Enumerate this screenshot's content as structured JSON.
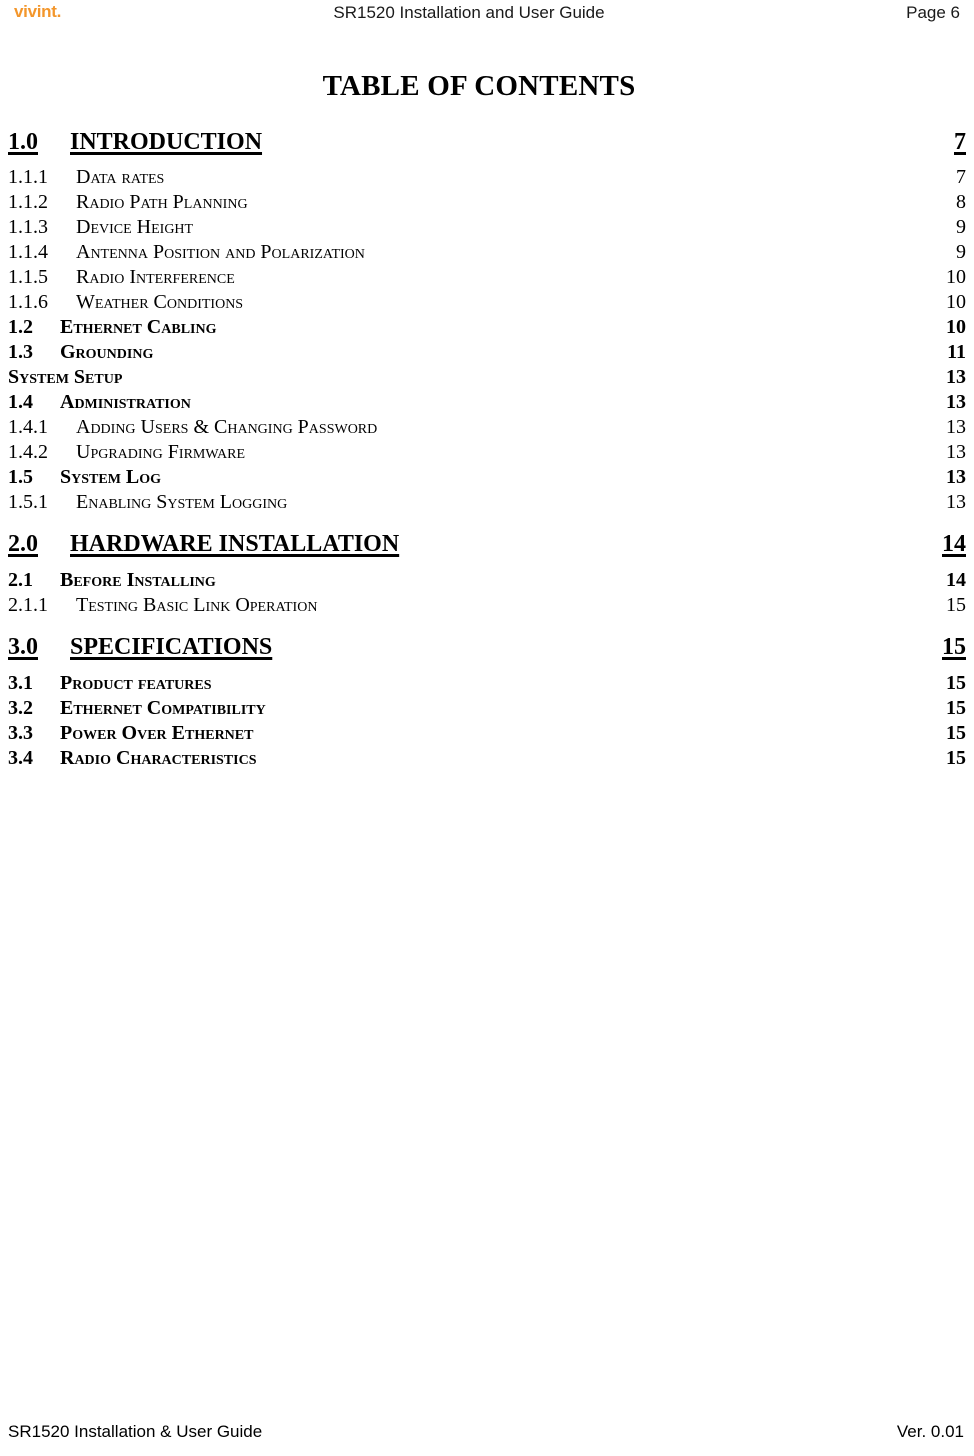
{
  "header": {
    "logo_text": "vivint.",
    "logo_color": "#F3962B",
    "title": "SR1520 Installation and User Guide",
    "page_label": "Page 6"
  },
  "toc": {
    "heading": "TABLE OF CONTENTS",
    "entries": [
      {
        "level": 1,
        "number": "1.0",
        "title": "INTRODUCTION",
        "page": "7"
      },
      {
        "level": 3,
        "number": "1.1.1",
        "title": "Data rates",
        "page": "7"
      },
      {
        "level": 3,
        "number": "1.1.2",
        "title": "Radio Path Planning",
        "page": "8"
      },
      {
        "level": 3,
        "number": "1.1.3",
        "title": "Device Height",
        "page": "9"
      },
      {
        "level": 3,
        "number": "1.1.4",
        "title": "Antenna Position and Polarization",
        "page": "9"
      },
      {
        "level": 3,
        "number": "1.1.5",
        "title": "Radio Interference",
        "page": "10"
      },
      {
        "level": 3,
        "number": "1.1.6",
        "title": "Weather Conditions",
        "page": "10"
      },
      {
        "level": 2,
        "number": "1.2",
        "title": "Ethernet Cabling",
        "page": "10"
      },
      {
        "level": 2,
        "number": "1.3",
        "title": "Grounding",
        "page": "11"
      },
      {
        "level": 2,
        "number": "",
        "title": "System Setup",
        "page": "13"
      },
      {
        "level": 2,
        "number": "1.4",
        "title": "Administration",
        "page": "13"
      },
      {
        "level": 3,
        "number": "1.4.1",
        "title": "Adding Users & Changing Password",
        "page": "13"
      },
      {
        "level": 3,
        "number": "1.4.2",
        "title": "Upgrading Firmware",
        "page": "13"
      },
      {
        "level": 2,
        "number": "1.5",
        "title": "System Log",
        "page": "13"
      },
      {
        "level": 3,
        "number": "1.5.1",
        "title": "Enabling System Logging",
        "page": "13"
      },
      {
        "level": 1,
        "number": "2.0",
        "title": "HARDWARE INSTALLATION",
        "page": "14"
      },
      {
        "level": 2,
        "number": "2.1",
        "title": "Before Installing",
        "page": "14"
      },
      {
        "level": 3,
        "number": "2.1.1",
        "title": "Testing Basic Link Operation",
        "page": "15"
      },
      {
        "level": 1,
        "number": "3.0",
        "title": "SPECIFICATIONS",
        "page": "15"
      },
      {
        "level": 2,
        "number": "3.1",
        "title": "Product features",
        "page": "15"
      },
      {
        "level": 2,
        "number": "3.2",
        "title": "Ethernet Compatibility",
        "page": "15"
      },
      {
        "level": 2,
        "number": "3.3",
        "title": "Power Over Ethernet",
        "page": "15"
      },
      {
        "level": 2,
        "number": "3.4",
        "title": "Radio Characteristics",
        "page": "15"
      }
    ]
  },
  "footer": {
    "left": "SR1520 Installation & User Guide",
    "right": "Ver. 0.01"
  }
}
